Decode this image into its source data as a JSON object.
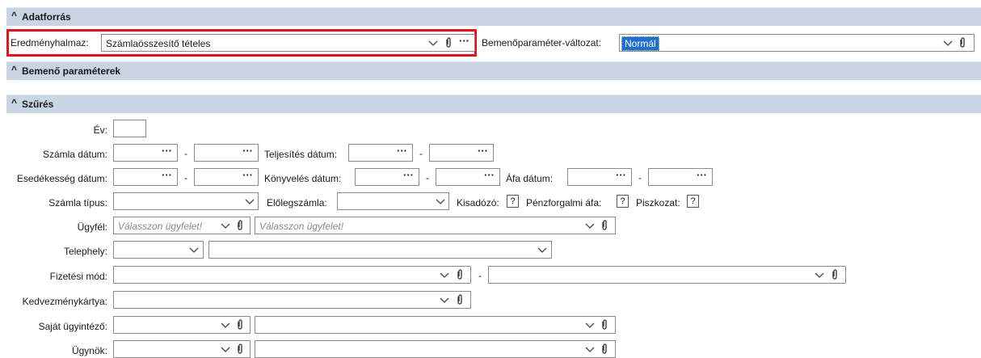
{
  "sections": {
    "datasource": "Adatforrás",
    "input_params": "Bemenő paraméterek",
    "filter": "Szűrés"
  },
  "datasource": {
    "result_set_label": "Eredményhalmaz:",
    "result_set_value": "Számlaösszesítő tételes",
    "variant_label": "Bemenőparaméter-változat:",
    "variant_value": "Normál"
  },
  "filter": {
    "year_label": "Év:",
    "invoice_date_label": "Számla dátum:",
    "completion_date_label": "Teljesítés dátum:",
    "due_date_label": "Esedékesség dátum:",
    "booking_date_label": "Könyvelés dátum:",
    "vat_date_label": "Áfa dátum:",
    "invoice_type_label": "Számla típus:",
    "advance_invoice_label": "Előlegszámla:",
    "small_taxpayer_label": "Kisadózó:",
    "cash_vat_label": "Pénzforgalmi áfa:",
    "draft_label": "Piszkozat:",
    "question_mark": "?",
    "dash": "-",
    "customer_label": "Ügyfél:",
    "customer_placeholder": "Válasszon ügyfelet!",
    "site_label": "Telephely:",
    "payment_method_label": "Fizetési mód:",
    "discount_card_label": "Kedvezménykártya:",
    "own_agent_label": "Saját ügyintéző:",
    "agent_label": "Ügynök:",
    "ellipsis": "···"
  },
  "colors": {
    "section_bg": "#c9d5e3",
    "highlight_border": "#e0141a",
    "selection_bg": "#1f6fd1"
  }
}
